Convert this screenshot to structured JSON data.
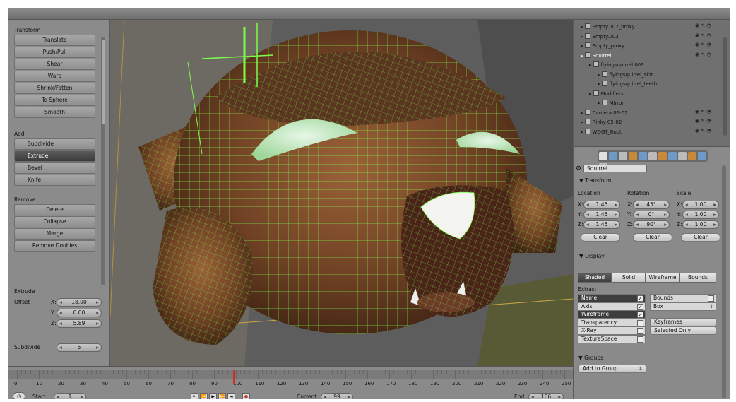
{
  "toolshelf": {
    "transform_header": "Transform",
    "transform_buttons": [
      "Translate",
      "Push/Pull",
      "Shear",
      "Warp",
      "Shrink/Fatten",
      "To Sphere",
      "Smooth"
    ],
    "add_header": "Add",
    "add_buttons": [
      "Subdivide",
      "Extrude",
      "Bevel",
      "Knife"
    ],
    "add_active": "Extrude",
    "remove_header": "Remove",
    "remove_buttons": [
      "Delete",
      "Collapse",
      "Merge",
      "Remove Doubles"
    ],
    "extrude_header": "Extrude",
    "offset_label": "Offset",
    "offset": {
      "x_label": "X:",
      "x": "18.00",
      "y_label": "Y:",
      "y": "0.00",
      "z_label": "Z:",
      "z": "5.89"
    },
    "subdivide_label": "Subdivide",
    "subdivide_value": "5"
  },
  "outliner": {
    "rows": [
      {
        "label": "Empty.002_proxy",
        "indent": 0
      },
      {
        "label": "Empty.003",
        "indent": 0
      },
      {
        "label": "Empty_proxy",
        "indent": 0
      },
      {
        "label": "Squirrel",
        "indent": 0,
        "selected": true
      },
      {
        "label": "flyingsquirrel.003",
        "indent": 1
      },
      {
        "label": "flyingsquirrel_skin",
        "indent": 2
      },
      {
        "label": "flyingsquirrel_teeth",
        "indent": 2
      },
      {
        "label": "Modifiers",
        "indent": 1
      },
      {
        "label": "Mirror",
        "indent": 2
      },
      {
        "label": "Camera 05-02",
        "indent": 0
      },
      {
        "label": "Rinky 05-02",
        "indent": 0
      },
      {
        "label": "WOGT_Root",
        "indent": 0
      }
    ]
  },
  "properties": {
    "object_name": "Squirrel",
    "transform_header": "Transform",
    "col_location": "Location",
    "col_rotation": "Rotation",
    "col_scale": "Scale",
    "location": {
      "x": "1.45",
      "y": "1.45",
      "z": "1.45"
    },
    "rotation": {
      "x": "45°",
      "y": "0°",
      "z": "90°"
    },
    "scale": {
      "x": "1.00",
      "y": "1.00",
      "z": "1.00"
    },
    "axis_x": "X:",
    "axis_y": "Y:",
    "axis_z": "Z:",
    "clear_label": "Clear",
    "display_header": "Display",
    "display_modes": [
      "Shaded",
      "Solid",
      "Wireframe",
      "Bounds"
    ],
    "display_active": "Shaded",
    "extras_label": "Extras:",
    "extras": [
      {
        "label": "Name",
        "checked": true,
        "highlight": true
      },
      {
        "label": "Axis",
        "checked": true,
        "highlight": false
      },
      {
        "label": "Wireframe",
        "checked": true,
        "highlight": true
      },
      {
        "label": "Transparency",
        "checked": false,
        "highlight": false
      },
      {
        "label": "X-Ray",
        "checked": false,
        "highlight": false
      },
      {
        "label": "TextureSpace",
        "checked": false,
        "highlight": false
      }
    ],
    "bounds_label": "Bounds",
    "bounds_type": "Box",
    "keyframes_label": "Keyframes",
    "selected_only_label": "Selected Only",
    "groups_header": "Groups",
    "add_to_group": "Add to Group"
  },
  "timeline": {
    "ticks": [
      "0",
      "10",
      "20",
      "30",
      "40",
      "50",
      "60",
      "70",
      "80",
      "90",
      "100",
      "110",
      "120",
      "130",
      "140",
      "150",
      "160",
      "170",
      "180",
      "190",
      "200",
      "210",
      "220",
      "230",
      "240",
      "250"
    ],
    "start_label": "Start:",
    "start_value": "1",
    "current_label": "Current:",
    "current_value": "99",
    "end_label": "End:",
    "end_value": "166"
  },
  "colors": {
    "accent_wire": "#7dff4a",
    "mesh_brown": "#7a4a2a",
    "active_button": "#3d3d3d",
    "playhead": "#d03020"
  }
}
